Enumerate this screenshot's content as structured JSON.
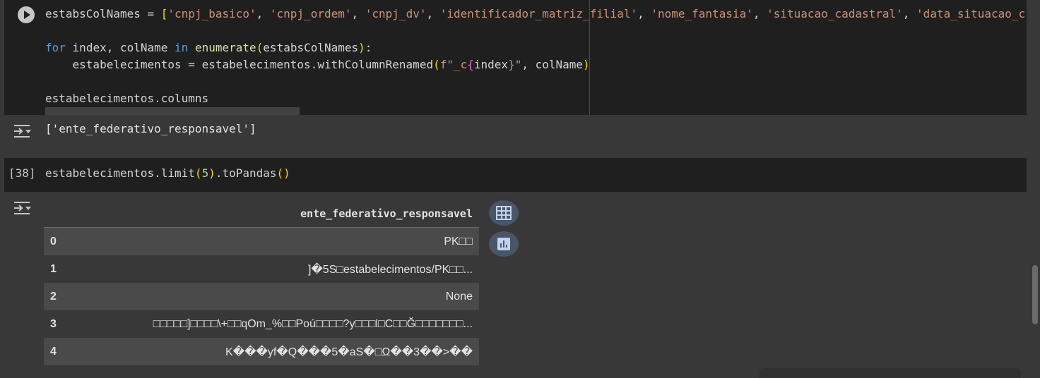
{
  "cell1": {
    "line1_prefix": "estabsColNames",
    "line1_strings": [
      "'cnpj_basico'",
      "'cnpj_ordem'",
      "'cnpj_dv'",
      "'identificador_matriz_filial'",
      "'nome_fantasia'",
      "'situacao_cadastral'",
      "'data_situacao_c"
    ],
    "loop_var": "index, colName",
    "loop_fn": "enumerate",
    "loop_arg": "estabsColNames",
    "body_target": "estabelecimentos",
    "body_call": "estabelecimentos.withColumnRenamed",
    "fstring_prefix": "f\"_c",
    "fstring_var": "index",
    "fstring_suffix": "\"",
    "body_arg2": "colName",
    "last_line": "estabelecimentos.columns"
  },
  "output1": {
    "text": "['ente_federativo_responsavel']"
  },
  "cell2": {
    "exec_count": "[38]",
    "code_obj": "estabelecimentos.limit",
    "code_arg": "5",
    "code_method": ".toPandas"
  },
  "dataframe": {
    "header": "ente_federativo_responsavel",
    "rows": [
      {
        "index": "0",
        "value": "PK□□"
      },
      {
        "index": "1",
        "value": "]�5S□estabelecimentos/PK□□..."
      },
      {
        "index": "2",
        "value": "None"
      },
      {
        "index": "3",
        "value": "□□□□□]□□□□\\+□□qOm_%□□Poú□□□□?y□□□l□C□□Ğ□□□□□□□..."
      },
      {
        "index": "4",
        "value": "K���yf�Q���5�aS�□Ω��3��>��"
      }
    ]
  },
  "icons": {
    "run": "play-icon",
    "output_toggle": "output-toggle-icon",
    "table_view": "table-icon",
    "chart_suggest": "bar-chart-icon"
  }
}
